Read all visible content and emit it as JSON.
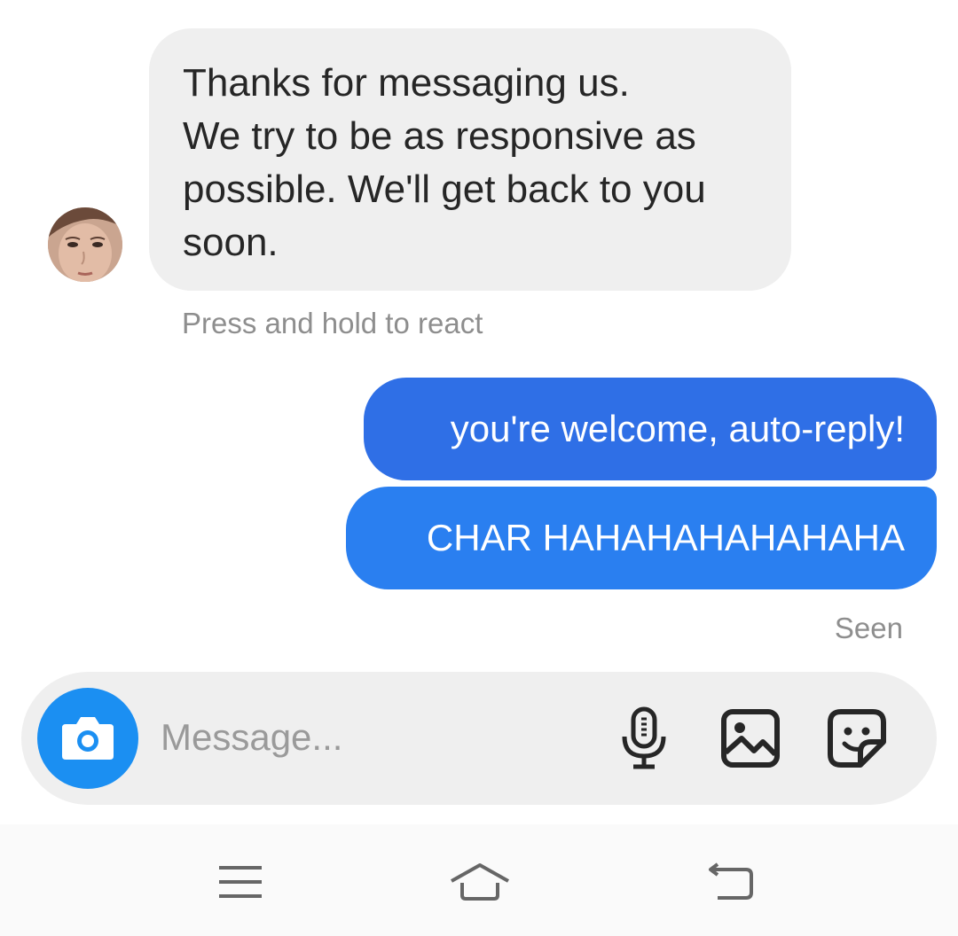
{
  "conversation": {
    "incoming": {
      "lines": [
        "Thanks for messaging us.",
        "We try to be as responsive as",
        "possible. We'll get back to you",
        "soon."
      ],
      "hint": "Press and hold to react"
    },
    "outgoing": [
      "you're welcome, auto-reply!",
      "CHAR HAHAHAHAHAHAHA"
    ],
    "status": "Seen"
  },
  "composer": {
    "placeholder": "Message...",
    "icons": [
      "camera-icon",
      "microphone-icon",
      "gallery-icon",
      "sticker-icon"
    ]
  },
  "navbar": {
    "icons": [
      "menu-icon",
      "home-icon",
      "back-icon"
    ]
  },
  "colors": {
    "incoming_bubble": "#efefef",
    "outgoing_bubble_1": "#2f6fe6",
    "outgoing_bubble_2": "#2a7ff0",
    "camera_button": "#1b8ff2",
    "secondary_text": "#8e8e8e"
  }
}
